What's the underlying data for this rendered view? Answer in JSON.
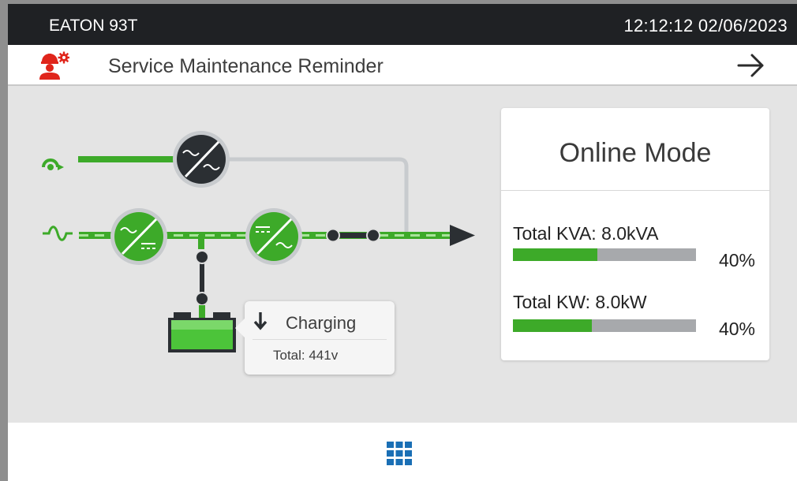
{
  "header": {
    "model": "EATON 93T",
    "datetime": "12:12:12  02/06/2023"
  },
  "reminder": {
    "icon": "technician-gear-icon",
    "title": "Service Maintenance Reminder",
    "action_icon": "arrow-right-icon"
  },
  "battery": {
    "status": "Charging",
    "status_icon": "arrow-down-icon",
    "total": "Total:  441v"
  },
  "mode": {
    "title": "Online Mode",
    "metrics": [
      {
        "label": "Total KVA: 8.0kVA",
        "percent": "40%",
        "fill_fraction": 0.46
      },
      {
        "label": "Total KW: 8.0kW",
        "percent": "40%",
        "fill_fraction": 0.43
      }
    ]
  },
  "footer": {
    "menu_icon": "grid-menu-icon"
  },
  "colors": {
    "active_green": "#3daa29",
    "alert_red": "#e0251b",
    "menu_blue": "#1a6fb5",
    "inactive_dark": "#2b2f33",
    "bypass_gray": "#c8cbce"
  }
}
